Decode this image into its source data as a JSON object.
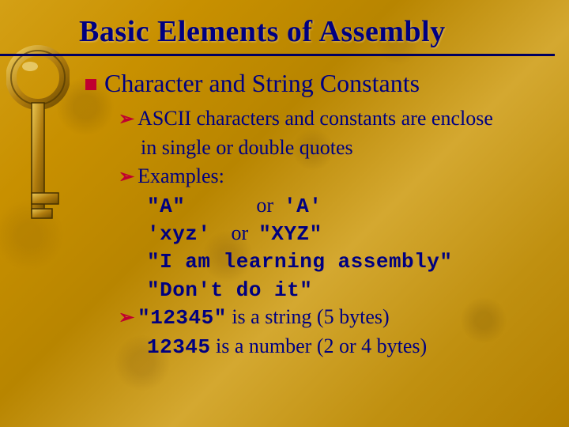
{
  "title": "Basic Elements of Assembly",
  "lvl1": {
    "text": "Character and String Constants"
  },
  "b1": {
    "line1": "ASCII characters and constants are enclose",
    "line2": "in single or double quotes"
  },
  "b2": {
    "label": "Examples:"
  },
  "ex": {
    "r1a": "\"A\"",
    "or": "or",
    "r1b": "'A'",
    "r2a": "'xyz'",
    "r2b": "\"XYZ\"",
    "r3": "\"I am learning assembly\"",
    "r4": "\"Don't do it\""
  },
  "b3": {
    "code1": "\"12345\"",
    "tail1": " is a string (5 bytes)",
    "code2": "12345",
    "tail2": " is a number (2 or 4 bytes)"
  },
  "icons": {
    "key": "key-icon"
  }
}
